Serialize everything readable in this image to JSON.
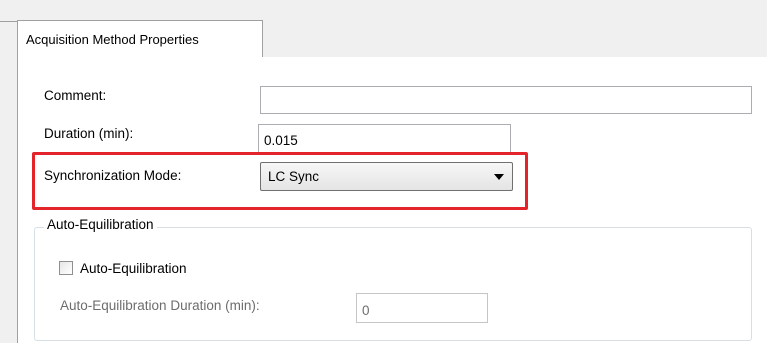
{
  "tabs": [
    {
      "label": "Acquisition Method Properties",
      "active": true
    }
  ],
  "form": {
    "comment": {
      "label": "Comment:",
      "value": ""
    },
    "duration": {
      "label": "Duration (min):",
      "value": "0.015"
    },
    "sync_mode": {
      "label": "Synchronization Mode:",
      "value": "LC Sync"
    }
  },
  "auto_equilibration": {
    "group_title": "Auto-Equilibration",
    "checkbox_label": "Auto-Equilibration",
    "checked": false,
    "duration_label": "Auto-Equilibration Duration (min):",
    "duration_value": "0"
  },
  "colors": {
    "highlight": "#e3242b",
    "window_bg": "#f0f0f0",
    "panel_bg": "#ffffff",
    "disabled_text": "#6d6d6d"
  }
}
